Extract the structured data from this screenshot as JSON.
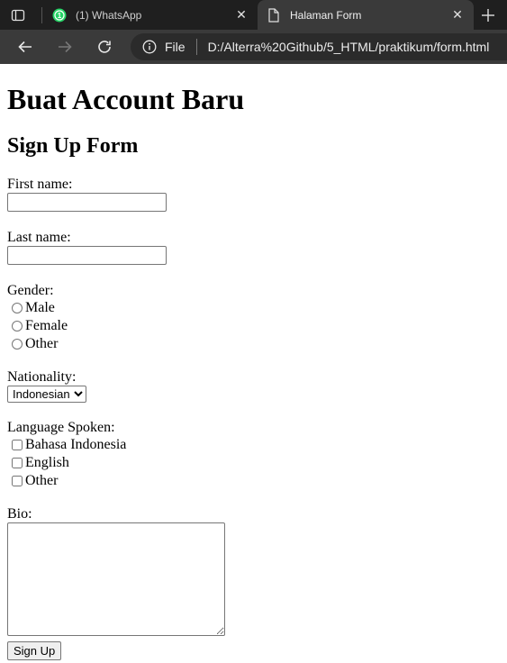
{
  "browser": {
    "tabs": [
      {
        "title": "(1) WhatsApp",
        "favicon": "whatsapp-icon",
        "badge": "1",
        "active": false
      },
      {
        "title": "Halaman Form",
        "favicon": "document-icon",
        "active": true
      }
    ],
    "address": {
      "scheme_label": "File",
      "url": "D:/Alterra%20Github/5_HTML/praktikum/form.html"
    },
    "colors": {
      "tabstrip": "#1f1f1f",
      "toolbar": "#3a3a3a",
      "whatsapp": "#25d366"
    }
  },
  "page": {
    "heading": "Buat Account Baru",
    "subheading": "Sign Up Form",
    "form": {
      "first_name_label": "First name:",
      "first_name_value": "",
      "last_name_label": "Last name:",
      "last_name_value": "",
      "gender_label": "Gender:",
      "gender_options": [
        "Male",
        "Female",
        "Other"
      ],
      "nationality_label": "Nationality:",
      "nationality_selected": "Indonesian",
      "language_label": "Language Spoken:",
      "language_options": [
        "Bahasa Indonesia",
        "English",
        "Other"
      ],
      "bio_label": "Bio:",
      "bio_value": "",
      "submit_label": "Sign Up"
    }
  }
}
